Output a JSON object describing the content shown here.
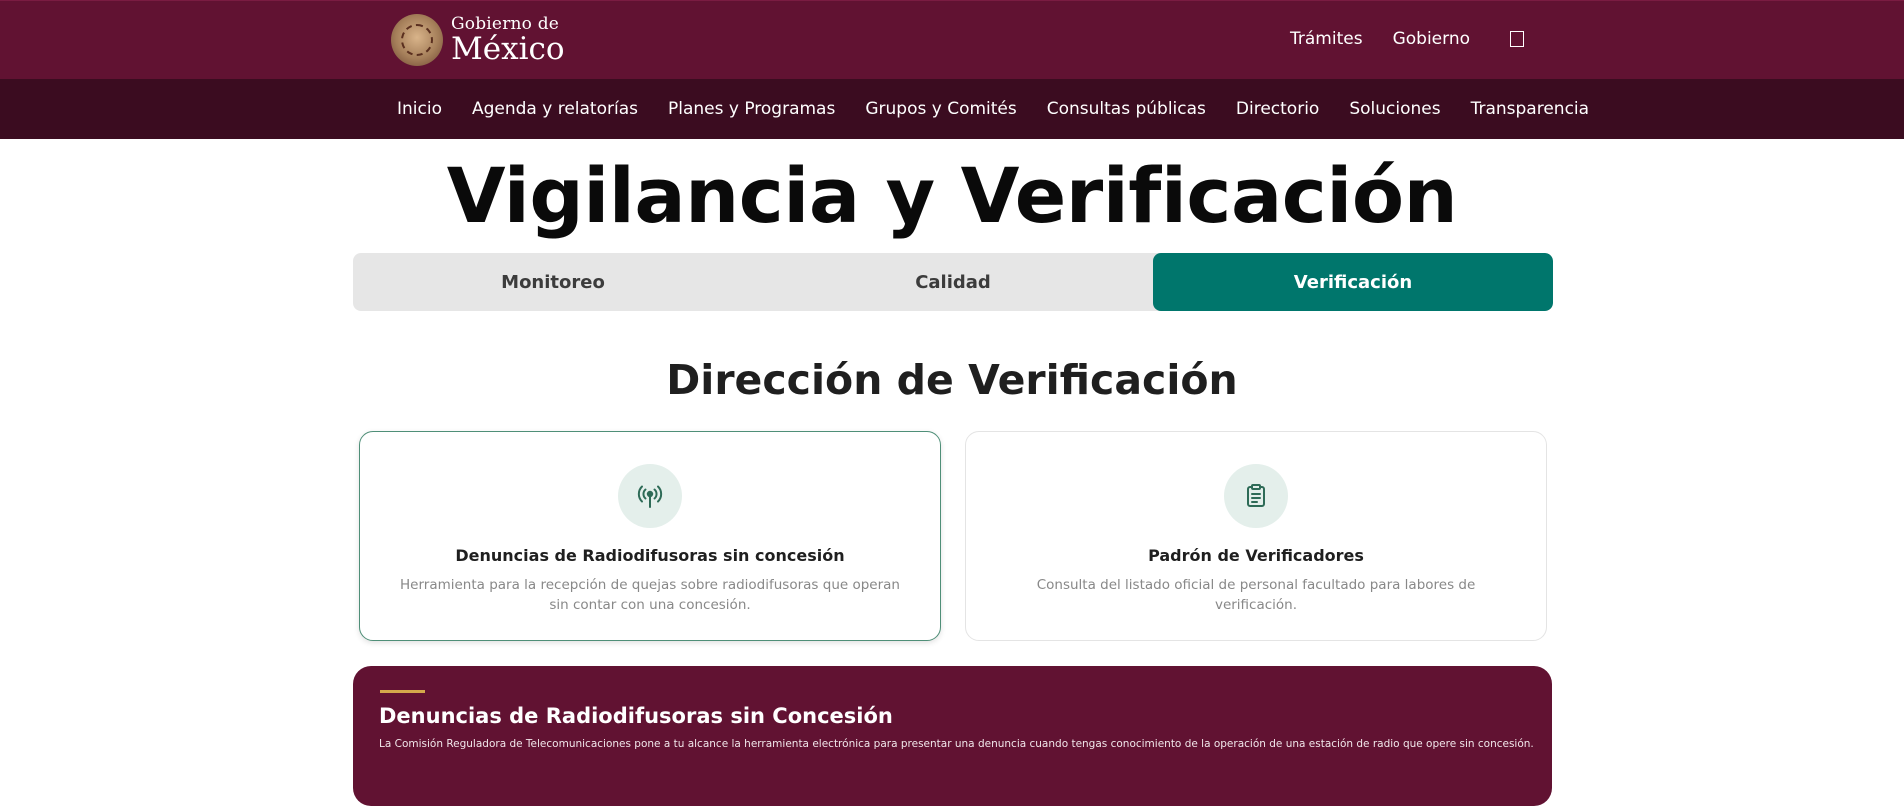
{
  "header": {
    "logo_line1": "Gobierno de",
    "logo_line2": "México",
    "links": [
      "Trámites",
      "Gobierno"
    ],
    "search_icon": "search-icon",
    "brand_color": "#611232"
  },
  "nav": {
    "items": [
      "Inicio",
      "Agenda y relatorías",
      "Planes y Programas",
      "Grupos y Comités",
      "Consultas públicas",
      "Directorio",
      "Soluciones",
      "Transparencia"
    ]
  },
  "page": {
    "title": "Vigilancia y Verificación"
  },
  "tabs": [
    {
      "label": "Monitoreo",
      "active": false
    },
    {
      "label": "Calidad",
      "active": false
    },
    {
      "label": "Verificación",
      "active": true
    }
  ],
  "section": {
    "title": "Dirección de Verificación"
  },
  "cards": [
    {
      "icon": "broadcast-tower-icon",
      "title": "Denuncias de Radiodifusoras sin concesión",
      "description": "Herramienta para la recepción de quejas sobre radiodifusoras que operan sin contar con una concesión.",
      "selected": true
    },
    {
      "icon": "clipboard-list-icon",
      "title": "Padrón de Verificadores",
      "description": "Consulta del listado oficial de personal facultado para labores de verificación.",
      "selected": false
    }
  ],
  "banner": {
    "title": "Denuncias de Radiodifusoras sin Concesión",
    "text": "La Comisión Reguladora de Telecomunicaciones pone a tu alcance la herramienta electrónica para presentar una denuncia cuando tengas conocimiento de la operación de una estación de radio que opere sin concesión.",
    "accent_color": "#d4a84b"
  },
  "colors": {
    "accent_green": "#00766c",
    "header_dark": "#3b0c20"
  }
}
